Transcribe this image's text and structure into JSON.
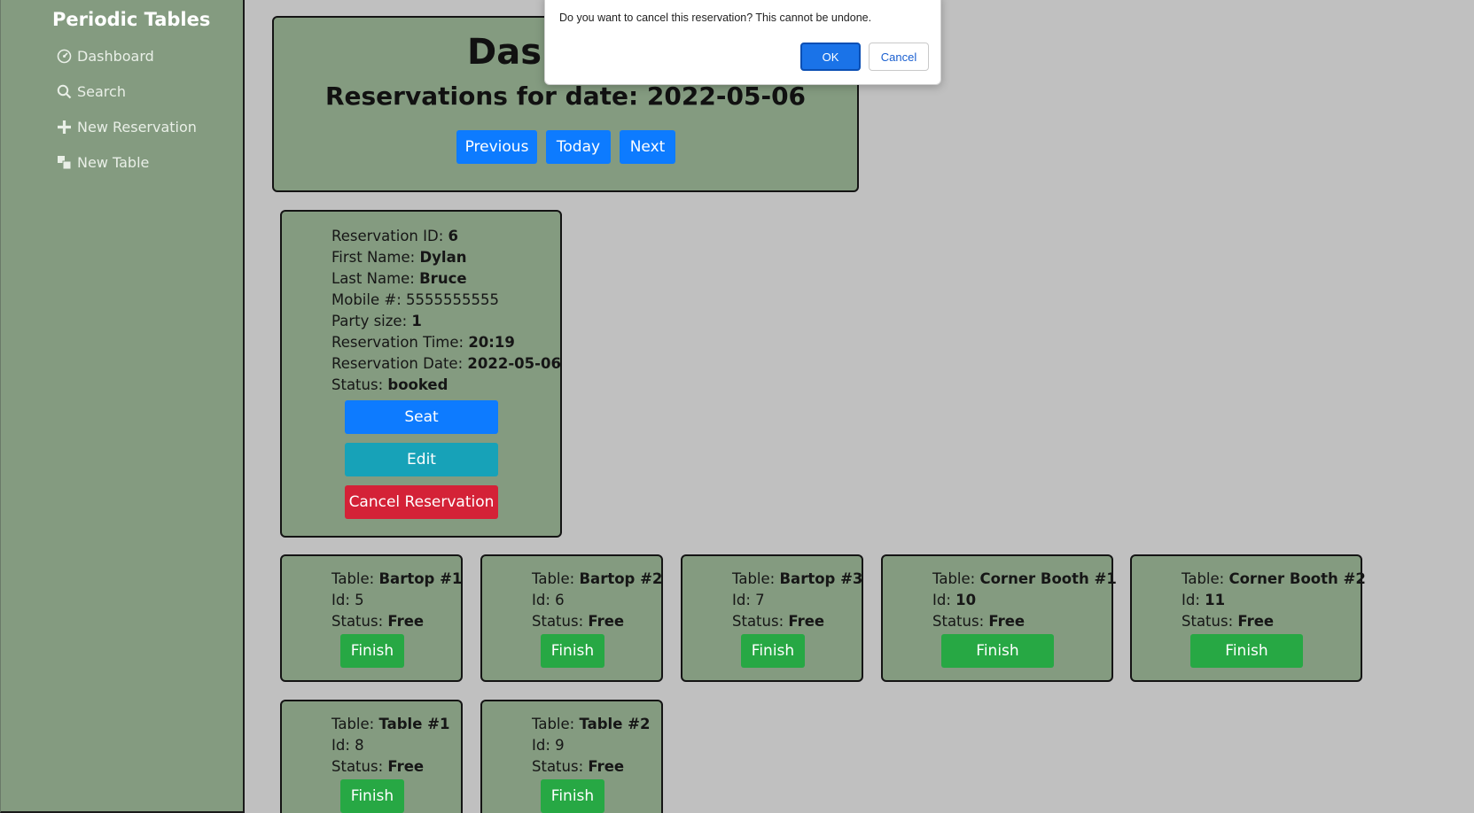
{
  "sidebar": {
    "brand": "Periodic Tables",
    "items": [
      {
        "label": "Dashboard",
        "icon": "dashboard-icon"
      },
      {
        "label": "Search",
        "icon": "search-icon"
      },
      {
        "label": "New Reservation",
        "icon": "plus-icon"
      },
      {
        "label": "New Table",
        "icon": "table-icon"
      }
    ]
  },
  "header": {
    "title": "Dashboard",
    "date_heading": "Reservations for date: 2022-05-06",
    "previous_label": "Previous",
    "today_label": "Today",
    "next_label": "Next"
  },
  "reservation": {
    "id_label": "Reservation ID:",
    "id": "6",
    "first_label": "First Name:",
    "first_name": "Dylan",
    "last_label": "Last Name:",
    "last_name": "Bruce",
    "mobile_label": "Mobile #:",
    "mobile": "5555555555",
    "party_label": "Party size:",
    "party_size": "1",
    "time_label": "Reservation Time:",
    "time": "20:19",
    "date_label": "Reservation Date:",
    "date": "2022-05-06",
    "status_label": "Status:",
    "status": "booked",
    "seat_label": "Seat",
    "edit_label": "Edit",
    "cancel_label": "Cancel Reservation"
  },
  "tables": [
    {
      "name": "Bartop #1",
      "id": "5",
      "status": "Free",
      "finish_label": "Finish"
    },
    {
      "name": "Bartop #2",
      "id": "6",
      "status": "Free",
      "finish_label": "Finish"
    },
    {
      "name": "Bartop #3",
      "id": "7",
      "status": "Free",
      "finish_label": "Finish"
    },
    {
      "name": "Corner Booth #1",
      "id": "10",
      "status": "Free",
      "finish_label": "Finish"
    },
    {
      "name": "Corner Booth #2",
      "id": "11",
      "status": "Free",
      "finish_label": "Finish"
    },
    {
      "name": "Table #1",
      "id": "8",
      "status": "Free",
      "finish_label": "Finish"
    },
    {
      "name": "Table #2",
      "id": "9",
      "status": "Free",
      "finish_label": "Finish"
    }
  ],
  "table_labels": {
    "table": "Table:",
    "id": "Id:",
    "status": "Status:"
  },
  "dialog": {
    "message": "Do you want to cancel this reservation? This cannot be undone.",
    "ok_label": "OK",
    "cancel_label": "Cancel"
  }
}
